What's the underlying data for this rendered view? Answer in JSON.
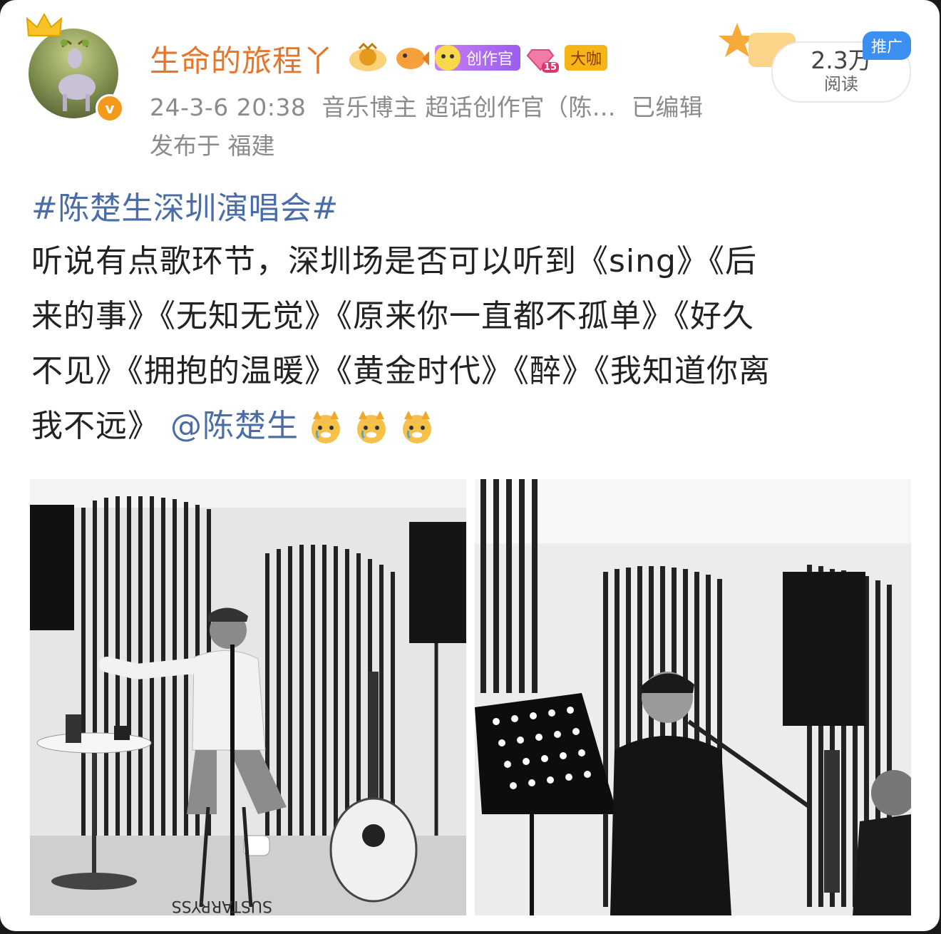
{
  "post": {
    "username": "生命的旅程丫",
    "badges": {
      "creator_label": "创作官",
      "level": "15",
      "daka_label": "大咖"
    },
    "meta": {
      "time": "24-3-6 20:38",
      "role": "音乐博主 超话创作官（陈...",
      "edited": "已编辑"
    },
    "location": "发布于 福建",
    "views": {
      "count": "2.3万",
      "label": "阅读"
    },
    "promo_tag": "推广",
    "topic": "#陈楚生深圳演唱会#",
    "content_lines": [
      "听说有点歌环节，深圳场是否可以听到《sing》《后",
      "来的事》《无知无觉》《原来你一直都不孤单》《好久",
      "不见》《拥抱的温暖》《黄金时代》《醉》《我知道你离"
    ],
    "content_last": "我不远》",
    "mention": "@陈楚生",
    "emoji_name": "crying-doge-emoji"
  },
  "icons": {
    "crown": "crown-icon",
    "verified": "verified-v-icon",
    "medal": "medal-icon",
    "fish": "fish-icon"
  },
  "colors": {
    "username": "#e8742a",
    "link": "#4a6da8",
    "meta": "#8b8b8b",
    "verified": "#f39a1a"
  }
}
